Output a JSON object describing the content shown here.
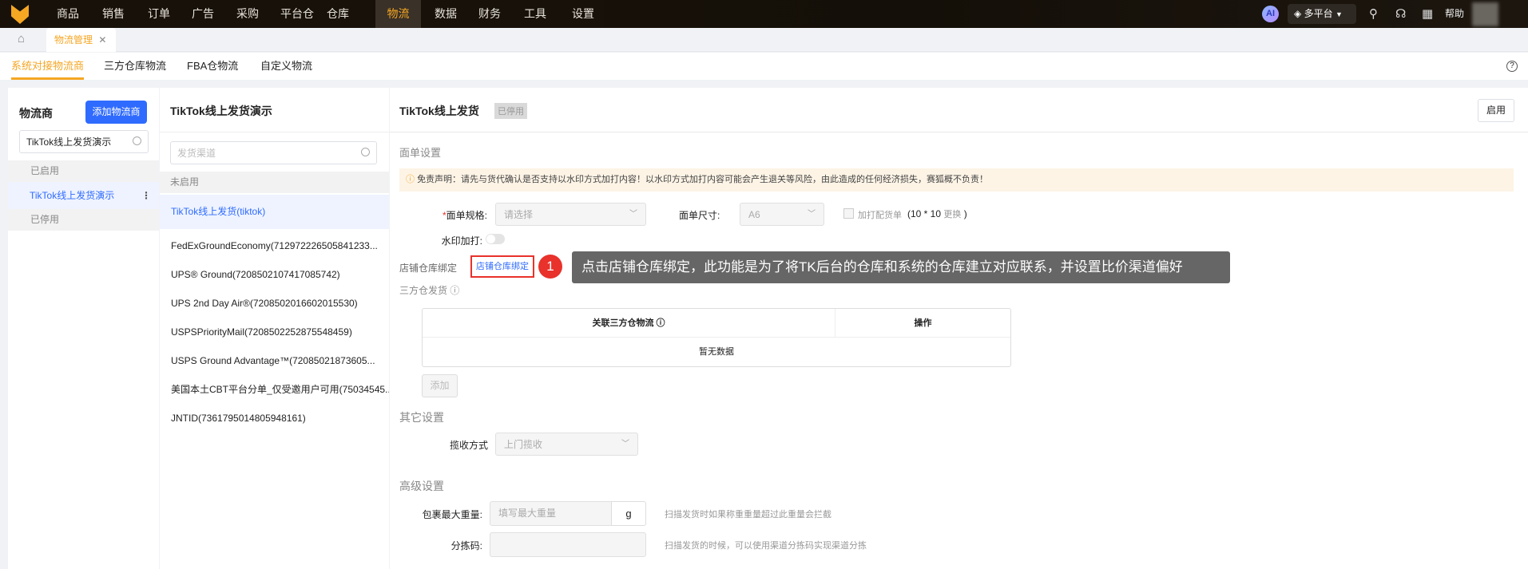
{
  "topnav": {
    "menu": [
      "商品",
      "销售",
      "订单",
      "广告",
      "采购",
      "平台仓",
      "仓库",
      "物流",
      "数据",
      "财务",
      "工具",
      "设置"
    ],
    "active": "物流",
    "ai": "AI",
    "platform": "多平台",
    "help": "帮助"
  },
  "tabs": {
    "current": "物流管理"
  },
  "subtabs": [
    "系统对接物流商",
    "三方仓库物流",
    "FBA仓物流",
    "自定义物流"
  ],
  "left": {
    "title": "物流商",
    "add_button": "添加物流商",
    "search_value": "TikTok线上发货演示",
    "group_enabled": "已启用",
    "selected": "TikTok线上发货演示",
    "group_disabled": "已停用"
  },
  "middle": {
    "title": "TikTok线上发货演示",
    "search_placeholder": "发货渠道",
    "group": "未启用",
    "items": [
      "TikTok线上发货(tiktok)",
      "FedExGroundEconomy(712972226505841233...",
      "UPS® Ground(7208502107417085742)",
      "UPS 2nd Day Air®(7208502016602015530)",
      "USPSPriorityMail(7208502252875548459)",
      "USPS Ground Advantage™(72085021873605...",
      "美国本土CBT平台分单_仅受邀用户可用(75034545...",
      "JNTID(7361795014805948161)"
    ]
  },
  "right": {
    "title": "TikTok线上发货",
    "status_badge": "已停用",
    "enable_button": "启用",
    "label_settings": "面单设置",
    "disclaimer": "免责声明：请先与货代确认是否支持以水印方式加打内容！以水印方式加打内容可能会产生退关等风险，由此造成的任何经济损失，赛狐概不负责！",
    "spec_label": "面单规格:",
    "spec_placeholder": "请选择",
    "size_label": "面单尺寸:",
    "size_value": "A6",
    "extra_print": "加打配货单",
    "size_note": "(10 * 10",
    "size_change": "更换",
    "size_note_end": ")",
    "watermark_label": "水印加打:",
    "store_bind_label": "店铺仓库绑定",
    "store_bind_link": "店铺仓库绑定",
    "step_number": "1",
    "tooltip": "点击店铺仓库绑定，此功能是为了将TK后台的仓库和系统的仓库建立对应联系，并设置比价渠道偏好",
    "third_party": "三方仓发货",
    "table_col1": "关联三方仓物流",
    "table_col2": "操作",
    "table_empty": "暂无数据",
    "add_button": "添加",
    "other_settings": "其它设置",
    "pickup_label": "揽收方式",
    "pickup_value": "上门揽收",
    "advanced": "高级设置",
    "max_weight_label": "包裹最大重量:",
    "max_weight_placeholder": "填写最大重量",
    "unit": "g",
    "max_weight_hint": "扫描发货时如果称重重量超过此重量会拦截",
    "sort_code_label": "分拣码:",
    "sort_code_hint": "扫描发货的时候，可以使用渠道分拣码实现渠道分拣"
  },
  "colors": {
    "accent": "#f5a623",
    "primary": "#2f6bff",
    "danger": "#e8322b"
  }
}
